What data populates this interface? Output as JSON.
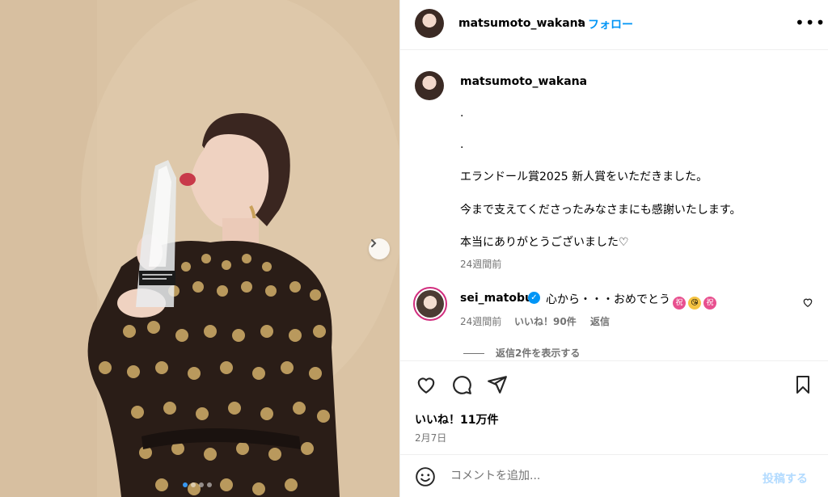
{
  "post": {
    "username": "matsumoto_wakana",
    "separator": "•",
    "follow_label": "フォロー",
    "more_label": "•••"
  },
  "caption": {
    "username": "matsumoto_wakana",
    "username_suffix": ".",
    "lines": [
      ".",
      ".",
      "エランドール賞2025 新人賞をいただきました。",
      "今まで支えてくださったみなさまにも感謝いたします。",
      "本当にありがとうございました♡"
    ],
    "time": "24週間前"
  },
  "comment": {
    "username": "sei_matobu",
    "text": "心から・・・おめでとう",
    "emoji_1": "祝",
    "emoji_2": "😘",
    "emoji_3": "祝",
    "time": "24週間前",
    "likes": "いいね！90件",
    "reply_label": "返信",
    "view_replies": "返信2件を表示する"
  },
  "actions": {
    "likes_count": "いいね！11万件",
    "date": "2月7日"
  },
  "comment_input": {
    "placeholder": "コメントを追加...",
    "post_label": "投稿する"
  },
  "carousel": {
    "slide_count": 4,
    "active_index": 0
  },
  "colors": {
    "link_blue": "#0095f6",
    "muted_text": "#737373",
    "border": "#efefef",
    "post_disabled": "#b3dbff"
  }
}
